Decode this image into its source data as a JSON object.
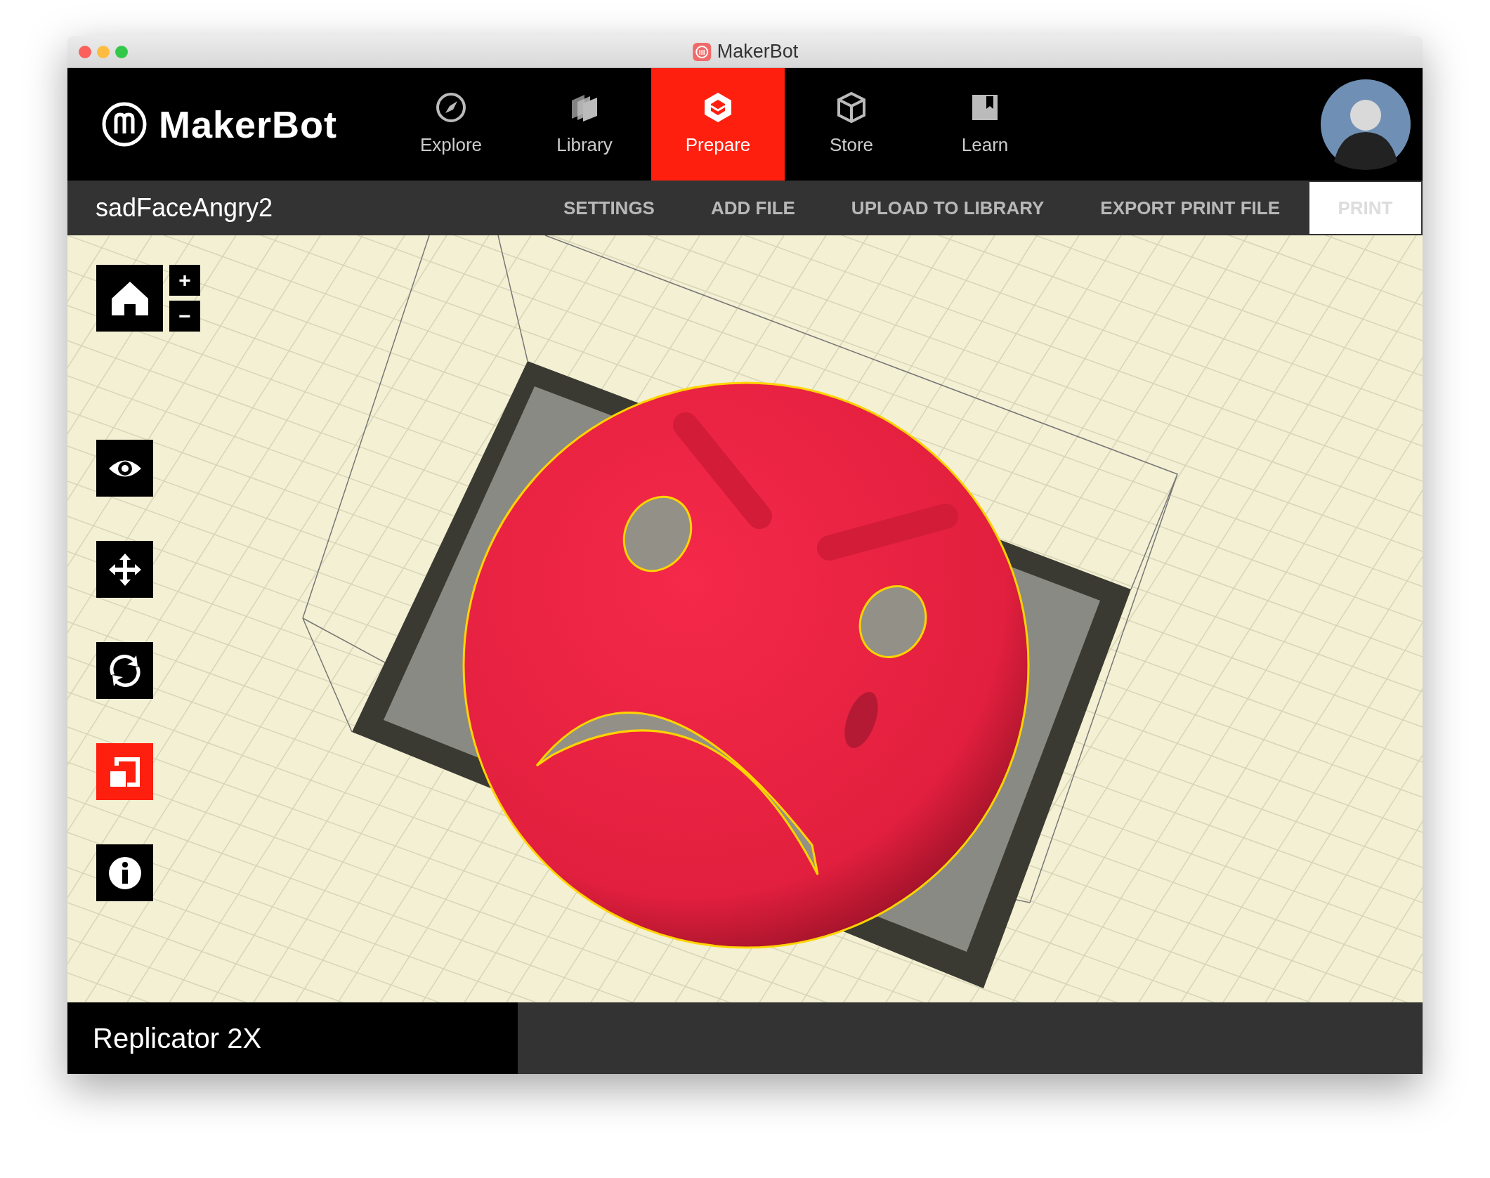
{
  "window": {
    "title": "MakerBot"
  },
  "brand": {
    "name": "MakerBot"
  },
  "nav_tabs": [
    {
      "label": "Explore",
      "kind": "explore",
      "selected": false
    },
    {
      "label": "Library",
      "kind": "library",
      "selected": false
    },
    {
      "label": "Prepare",
      "kind": "prepare",
      "selected": true
    },
    {
      "label": "Store",
      "kind": "store",
      "selected": false
    },
    {
      "label": "Learn",
      "kind": "learn",
      "selected": false
    }
  ],
  "toolbar": {
    "project_name": "sadFaceAngry2",
    "actions": [
      {
        "label": "SETTINGS",
        "kind": "link",
        "disabled": false
      },
      {
        "label": "ADD FILE",
        "kind": "link",
        "disabled": false
      },
      {
        "label": "UPLOAD TO LIBRARY",
        "kind": "link",
        "disabled": false
      },
      {
        "label": "EXPORT PRINT FILE",
        "kind": "link",
        "disabled": false
      },
      {
        "label": "PRINT",
        "kind": "primary",
        "disabled": true
      }
    ]
  },
  "view_controls": {
    "zoom_in": "+",
    "zoom_out": "−"
  },
  "tools": [
    {
      "kind": "view",
      "selected": false
    },
    {
      "kind": "move",
      "selected": false
    },
    {
      "kind": "rotate",
      "selected": false
    },
    {
      "kind": "scale",
      "selected": true
    },
    {
      "kind": "info",
      "selected": false
    }
  ],
  "status_bar": {
    "printer": "Replicator 2X"
  }
}
